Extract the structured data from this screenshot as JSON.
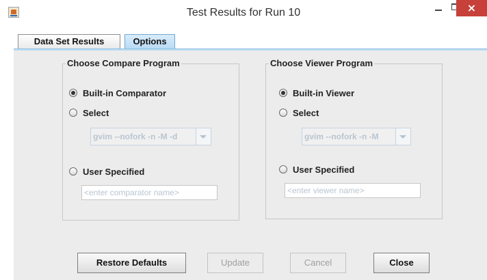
{
  "window": {
    "title": "Test Results for Run 10",
    "close_glyph": "×"
  },
  "tabs": [
    {
      "label": "Data Set Results",
      "selected": false
    },
    {
      "label": "Options",
      "selected": true
    }
  ],
  "compare_group": {
    "legend": "Choose Compare Program",
    "builtin_label": "Built-in Comparator",
    "select_label": "Select",
    "select_value": "gvim --nofork -n -M -d",
    "user_label": "User Specified",
    "user_placeholder": "<enter comparator name>",
    "selected_option": "Built-in Comparator"
  },
  "viewer_group": {
    "legend": "Choose Viewer Program",
    "builtin_label": "Built-in Viewer",
    "select_label": "Select",
    "select_value": "gvim --nofork -n -M",
    "user_label": "User Specified",
    "user_placeholder": "<enter viewer name>",
    "selected_option": "Built-in Viewer"
  },
  "buttons": {
    "restore": "Restore Defaults",
    "update": "Update",
    "cancel": "Cancel",
    "close": "Close"
  },
  "colors": {
    "close_button": "#c7403a",
    "active_tab": "#b9dbf5",
    "panel_bg": "#ececec"
  },
  "icons": {
    "app": "java-app-icon",
    "minimize": "minimize-icon",
    "maximize": "maximize-icon",
    "close": "close-icon",
    "combo_arrow": "chevron-down-icon"
  }
}
